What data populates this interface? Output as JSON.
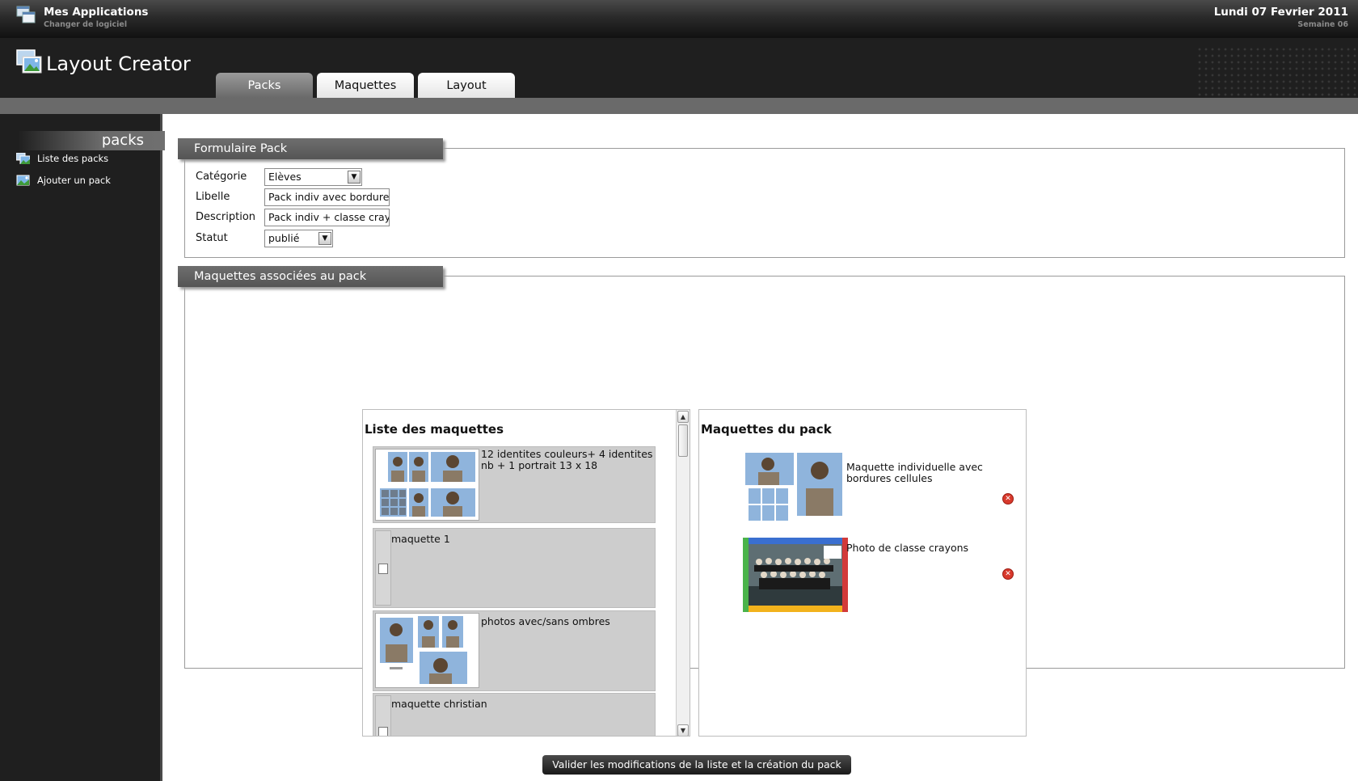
{
  "topbar": {
    "title": "Mes Applications",
    "subtitle": "Changer de logiciel",
    "date": "Lundi 07 Fevrier 2011",
    "week": "Semaine 06",
    "icon": "app-window-icon"
  },
  "header": {
    "logo_text": "Layout Creator",
    "logo_icon": "picture-icon",
    "tabs": [
      {
        "label": "Packs",
        "active": true
      },
      {
        "label": "Maquettes",
        "active": false
      },
      {
        "label": "Layout",
        "active": false
      }
    ]
  },
  "sidebar": {
    "title": "packs",
    "items": [
      {
        "label": "Liste des packs",
        "icon": "list-picture-icon"
      },
      {
        "label": "Ajouter un pack",
        "icon": "add-picture-icon"
      }
    ]
  },
  "form": {
    "legend": "Formulaire Pack",
    "fields": [
      {
        "label": "Catégorie",
        "value": "Elèves",
        "type": "select"
      },
      {
        "label": "Libelle",
        "value": "Pack indiv avec bordures c",
        "type": "text"
      },
      {
        "label": "Description",
        "value": "Pack indiv + classe crayo",
        "type": "text"
      },
      {
        "label": "Statut",
        "value": "publié",
        "type": "select"
      }
    ]
  },
  "maquettes": {
    "legend": "Maquettes associées au pack",
    "list_title": "Liste des maquettes",
    "list_items": [
      {
        "label": "12 identites couleurs+ 4 identites nb + 1 portrait 13 x 18",
        "has_thumb": true
      },
      {
        "label": "maquette 1",
        "has_thumb": false
      },
      {
        "label": "photos avec/sans ombres",
        "has_thumb": true
      },
      {
        "label": "maquette christian",
        "has_thumb": false
      }
    ],
    "pack_title": "Maquettes du pack",
    "pack_items": [
      {
        "label": "Maquette individuelle avec bordures cellules",
        "delete_icon": "remove-icon"
      },
      {
        "label": "Photo de classe crayons",
        "delete_icon": "remove-icon"
      }
    ],
    "submit_label": "Valider les modifications de la liste et la création du pack"
  }
}
